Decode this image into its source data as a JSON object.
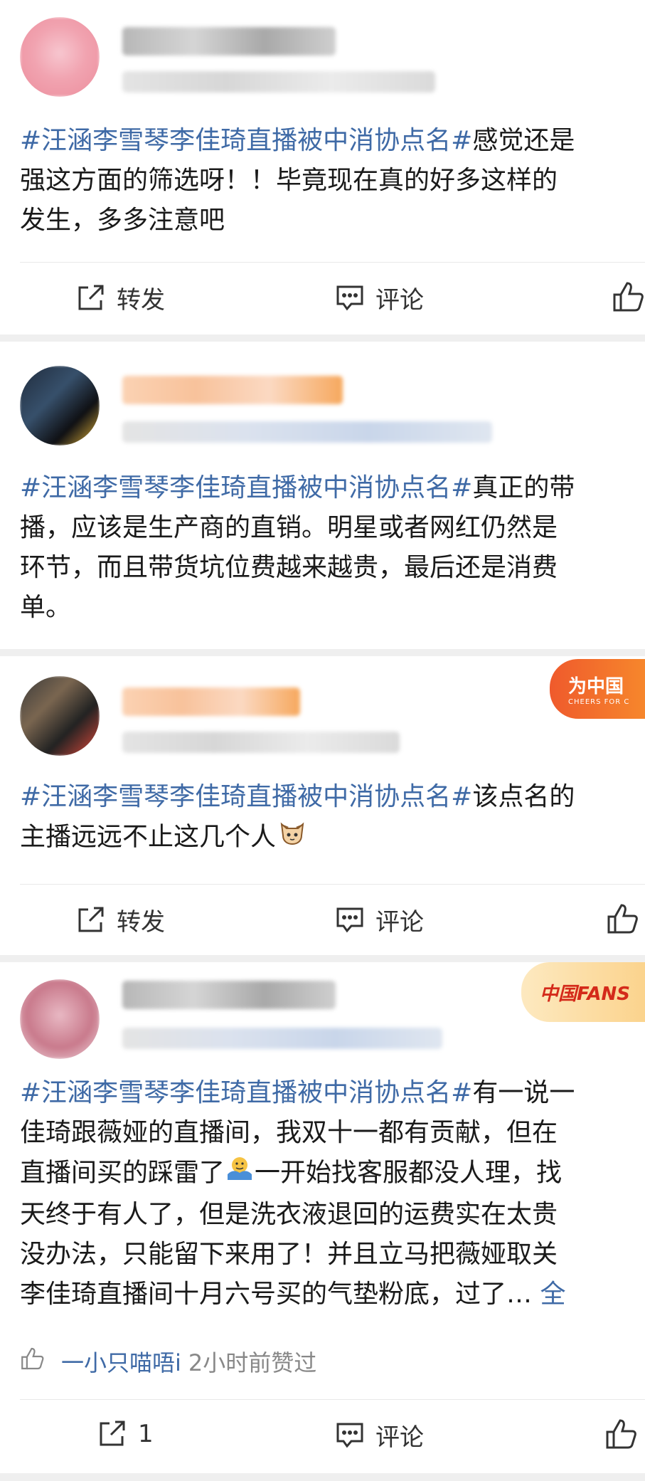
{
  "posts": [
    {
      "topic": "#汪涵李雪琴李佳琦直播被中消协点名#",
      "lines": [
        "感觉还是",
        "强这方面的筛选呀！！毕竟现在真的好多这样的",
        "发生，多多注意吧"
      ],
      "actions": {
        "repost": "转发",
        "comment": "评论"
      }
    },
    {
      "topic": "#汪涵李雪琴李佳琦直播被中消协点名#",
      "lines": [
        "真正的带",
        "播，应该是生产商的直销。明星或者网红仍然是",
        "环节，而且带货坑位费越来越贵，最后还是消费",
        "单。"
      ]
    },
    {
      "topic": "#汪涵李雪琴李佳琦直播被中消协点名#",
      "lines": [
        "该点名的",
        "主播远远不止这几个人"
      ],
      "emoji": "cat-face-icon",
      "badge": {
        "title": "为中国",
        "subtitle": "CHEERS FOR C"
      },
      "actions": {
        "repost": "转发",
        "comment": "评论"
      }
    },
    {
      "topic": "#汪涵李雪琴李佳琦直播被中消协点名#",
      "lines": [
        "有一说一",
        "佳琦跟薇娅的直播间，我双十一都有贡献，但在",
        "直播间买的踩雷了",
        "一开始找客服都没人理，找",
        "天终于有人了，但是洗衣液退回的运费实在太贵",
        "没办法，只能留下来用了！并且立马把薇娅取关",
        "李佳琦直播间十月六号买的气垫粉底，过了…"
      ],
      "more": "全",
      "badge": {
        "title": "中国FANS"
      },
      "liked_by": {
        "name": "一小只喵唔i",
        "time": "2小时前赞过"
      },
      "actions": {
        "repost": "1",
        "comment": "评论"
      }
    }
  ],
  "colors": {
    "topic": "#3f6aa6",
    "separator": "#efefef"
  }
}
